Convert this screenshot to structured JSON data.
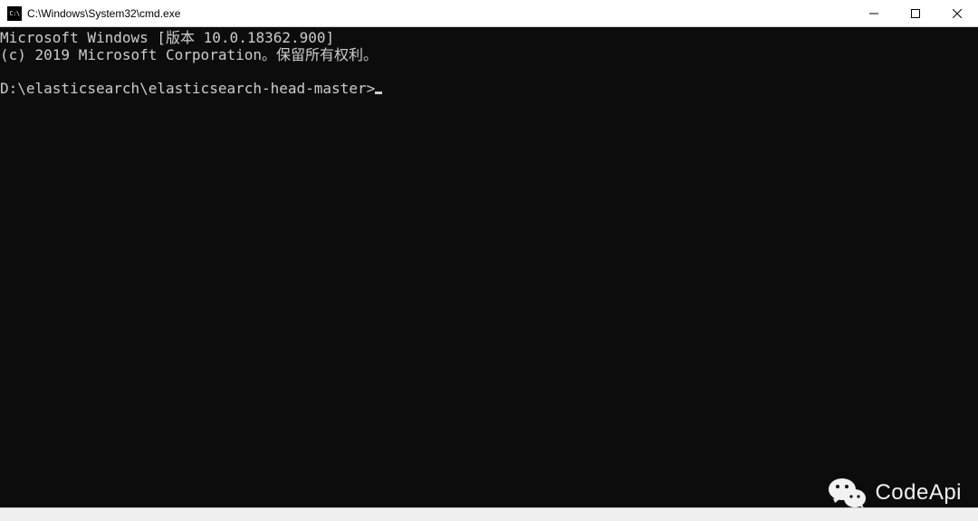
{
  "window": {
    "icon_label": "C:\\",
    "title": "C:\\Windows\\System32\\cmd.exe"
  },
  "terminal": {
    "line1": "Microsoft Windows [版本 10.0.18362.900]",
    "line2": "(c) 2019 Microsoft Corporation。保留所有权利。",
    "prompt": "D:\\elasticsearch\\elasticsearch-head-master>"
  },
  "watermark": {
    "text": "CodeApi"
  },
  "bottom": {
    "fragment": ""
  }
}
